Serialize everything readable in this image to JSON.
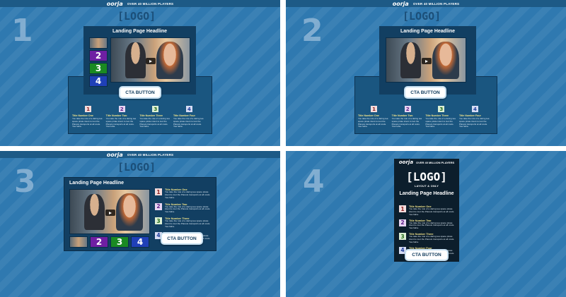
{
  "topbar": {
    "brand": "oorja",
    "tagline": "OVER 40 MILLION PLAYERS"
  },
  "logo_text": "[LOGO]",
  "layout_only": "LAYOUT & ONLY",
  "headline": "Landing Page Headline",
  "cta_label": "CTA BUTTON",
  "panel_numbers": [
    "1",
    "2",
    "3",
    "4"
  ],
  "thumb_numbers": [
    "2",
    "3",
    "4"
  ],
  "steps": [
    {
      "num": "1",
      "title": "Title Number One",
      "desc": "You take the role of a daring tea space pirate intent to loot the Planets transports at all costs. Yea haha."
    },
    {
      "num": "2",
      "title": "Title Number Two",
      "desc": "You take the role of a daring tea space pirate intent to loot the Planets transports at all costs. Yea haha."
    },
    {
      "num": "3",
      "title": "Title Number Three",
      "desc": "You take the role of a daring tea space pirate intent to loot the Planets transports at all costs. Yea haha."
    },
    {
      "num": "4",
      "title": "Title Number Four",
      "desc": "You take the role of a daring tea space pirate intent to loot the Planets transports at all costs. Yea haha."
    }
  ],
  "colors": {
    "background": "#2f79b0",
    "box": "#123f62",
    "step_title": "#f3e58a",
    "thumb2": "#6f1fa3",
    "thumb3": "#1a8a22",
    "thumb4": "#1f40b8"
  }
}
